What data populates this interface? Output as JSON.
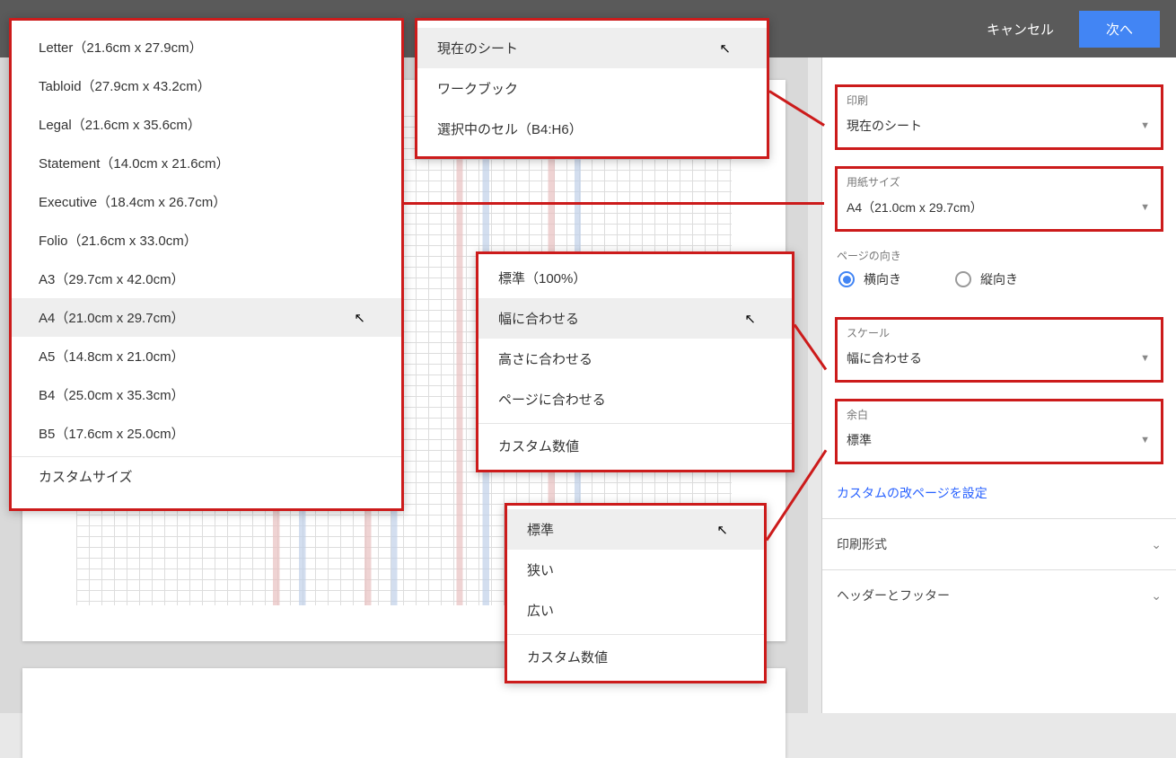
{
  "topbar": {
    "cancel": "キャンセル",
    "next": "次へ"
  },
  "sidebar": {
    "print": {
      "label": "印刷",
      "value": "現在のシート"
    },
    "paper": {
      "label": "用紙サイズ",
      "value": "A4（21.0cm x 29.7cm）"
    },
    "orientation": {
      "label": "ページの向き",
      "landscape": "横向き",
      "portrait": "縦向き",
      "selected": "landscape"
    },
    "scale": {
      "label": "スケール",
      "value": "幅に合わせる"
    },
    "margin": {
      "label": "余白",
      "value": "標準"
    },
    "custom_pagebreak": "カスタムの改ページを設定",
    "format_section": "印刷形式",
    "header_footer_section": "ヘッダーとフッター"
  },
  "print_menu": {
    "items": [
      "現在のシート",
      "ワークブック",
      "選択中のセル（B4:H6）"
    ],
    "hover_index": 0
  },
  "paper_menu": {
    "items": [
      "Letter（21.6cm x 27.9cm）",
      "Tabloid（27.9cm x 43.2cm）",
      "Legal（21.6cm x 35.6cm）",
      "Statement（14.0cm x 21.6cm）",
      "Executive（18.4cm x 26.7cm）",
      "Folio（21.6cm x 33.0cm）",
      "A3（29.7cm x 42.0cm）",
      "A4（21.0cm x 29.7cm）",
      "A5（14.8cm x 21.0cm）",
      "B4（25.0cm x 35.3cm）",
      "B5（17.6cm x 25.0cm）"
    ],
    "custom": "カスタムサイズ",
    "hover_index": 7
  },
  "scale_menu": {
    "items": [
      "標準（100%）",
      "幅に合わせる",
      "高さに合わせる",
      "ページに合わせる"
    ],
    "custom": "カスタム数値",
    "hover_index": 1
  },
  "margin_menu": {
    "items": [
      "標準",
      "狭い",
      "広い"
    ],
    "custom": "カスタム数値",
    "hover_index": 0
  }
}
